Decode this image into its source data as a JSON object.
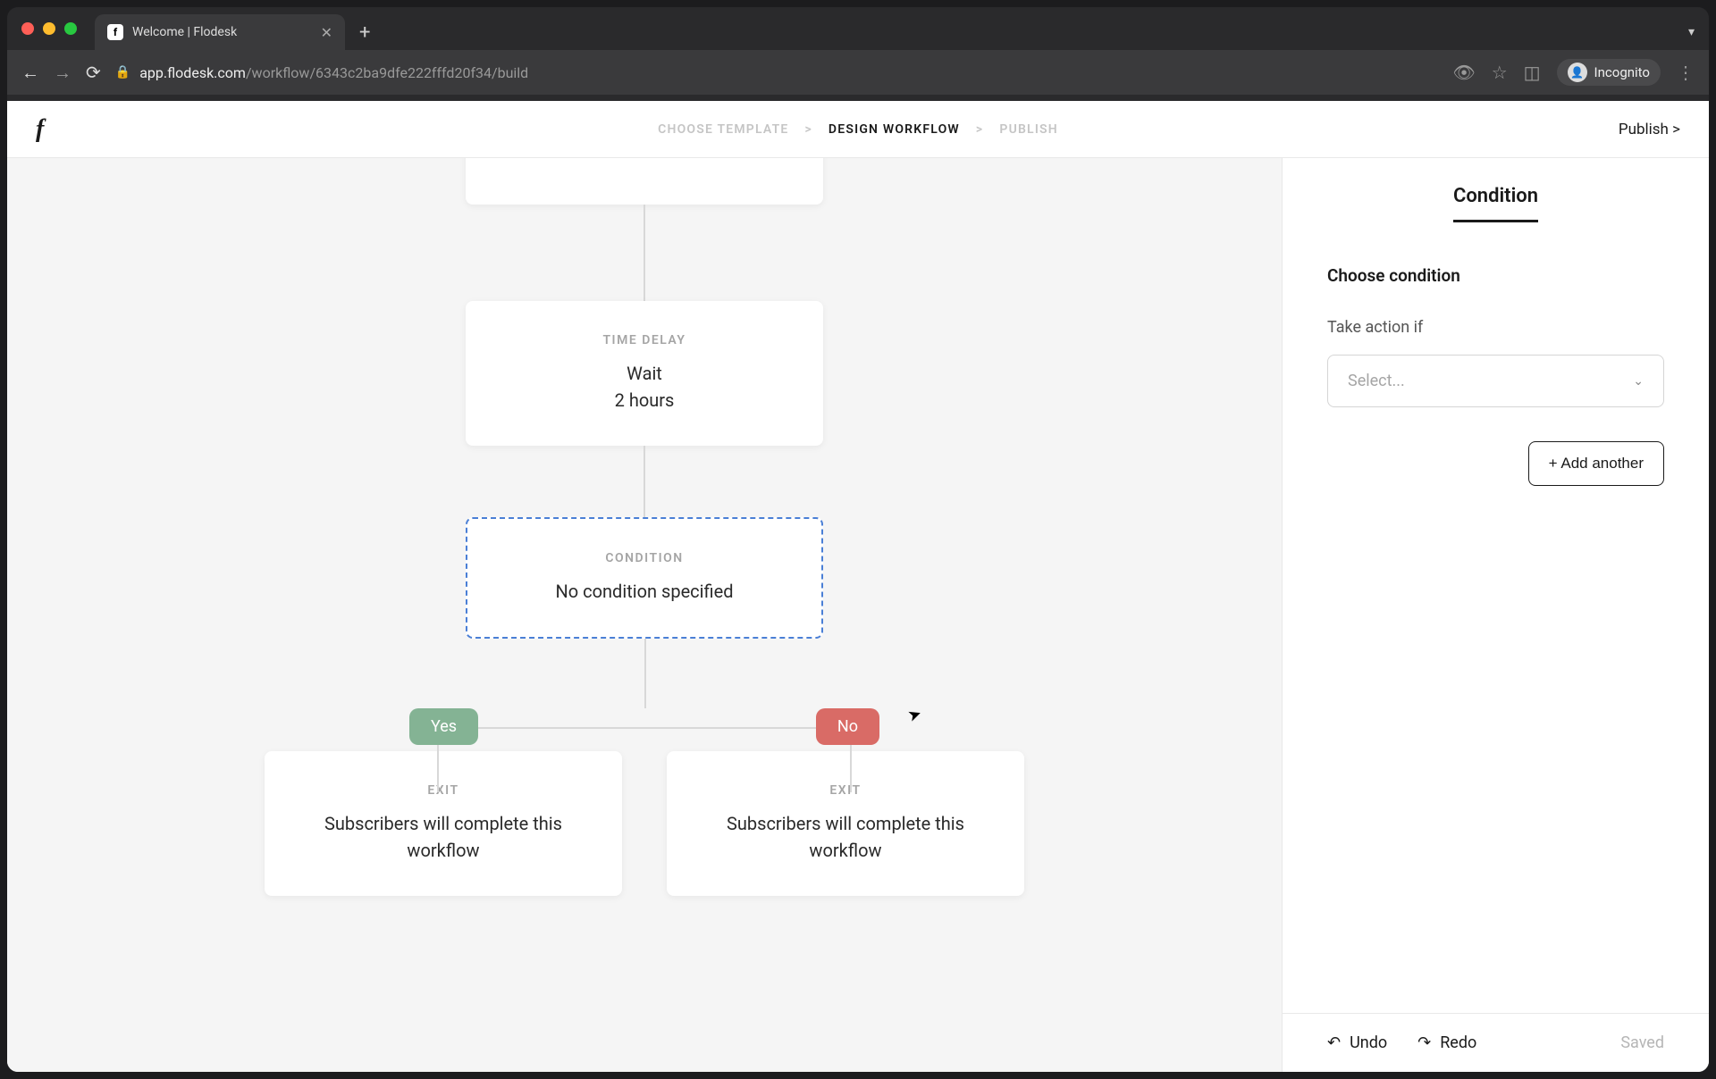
{
  "browser": {
    "tab_title": "Welcome | Flodesk",
    "url_host": "app.flodesk.com",
    "url_path": "/workflow/6343c2ba9dfe222fffd20f34/build",
    "incognito_label": "Incognito"
  },
  "header": {
    "logo": "f",
    "crumbs": {
      "choose": "CHOOSE TEMPLATE",
      "design": "DESIGN WORKFLOW",
      "publish": "PUBLISH"
    },
    "sep": ">",
    "publish_link": "Publish >"
  },
  "flow": {
    "time_delay": {
      "label": "TIME DELAY",
      "line1": "Wait",
      "line2": "2 hours"
    },
    "condition": {
      "label": "CONDITION",
      "text": "No condition specified"
    },
    "yes": "Yes",
    "no": "No",
    "exit": {
      "label": "EXIT",
      "text": "Subscribers will complete this workflow"
    }
  },
  "panel": {
    "tab": "Condition",
    "heading": "Choose condition",
    "subtext": "Take action if",
    "select_placeholder": "Select...",
    "add_another": "+ Add another"
  },
  "footer": {
    "undo": "Undo",
    "redo": "Redo",
    "saved": "Saved"
  }
}
